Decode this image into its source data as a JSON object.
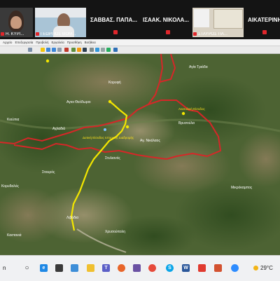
{
  "meeting": {
    "participants": [
      {
        "name": "Η. ΚΥΡΙ..."
      },
      {
        "name": "ΓΕΩΡΓΙΟΣ ΘΟΜ..."
      },
      {
        "name": "ΣΑΒΒΑΣ. ΠΑΠΑ..."
      },
      {
        "name": "ΙΣΑΑΚ. ΝΙΚΟΛΑ..."
      },
      {
        "name": "ΣΤΑΥΡΟΣ ΠΑ..."
      },
      {
        "name": "ΑΙΚΑΤΕΡΙΝΗ..."
      }
    ]
  },
  "app": {
    "menu": [
      "Αρχείο",
      "Επεξεργασία",
      "Προβολή",
      "Εργαλεία",
      "Προσθήκη",
      "Βοήθεια"
    ]
  },
  "map": {
    "place_labels": [
      "Αγιοι Θεόδωροι",
      "Αχλαδιά",
      "Κορυφή",
      "Αγία Τριάδα",
      "Βρυσούλα",
      "Κιούπια",
      "Στυλιανός",
      "Σταυρός",
      "Αγ. Νικόλαος",
      "Κορυδαλός",
      "Λιβάδια",
      "Καστανιά",
      "Χρυσούπολη",
      "Μικρόκαμπος"
    ],
    "route_labels": [
      "Δυτική Είσοδος Ιστορικής Διαδρομής",
      "Ανατολική Είσοδος"
    ],
    "route_color": "#f3e600",
    "border_color": "#d62728"
  },
  "taskbar": {
    "search_label": "n",
    "weather": "29°C",
    "icons": [
      "start-icon",
      "search-icon",
      "task-view-icon",
      "edge-icon",
      "file-explorer-icon",
      "store-icon",
      "mail-icon",
      "firefox-icon",
      "teams-icon",
      "chrome-icon",
      "viber-icon",
      "skype-icon",
      "word-icon",
      "acrobat-icon",
      "powerpoint-icon",
      "zoom-icon"
    ]
  }
}
